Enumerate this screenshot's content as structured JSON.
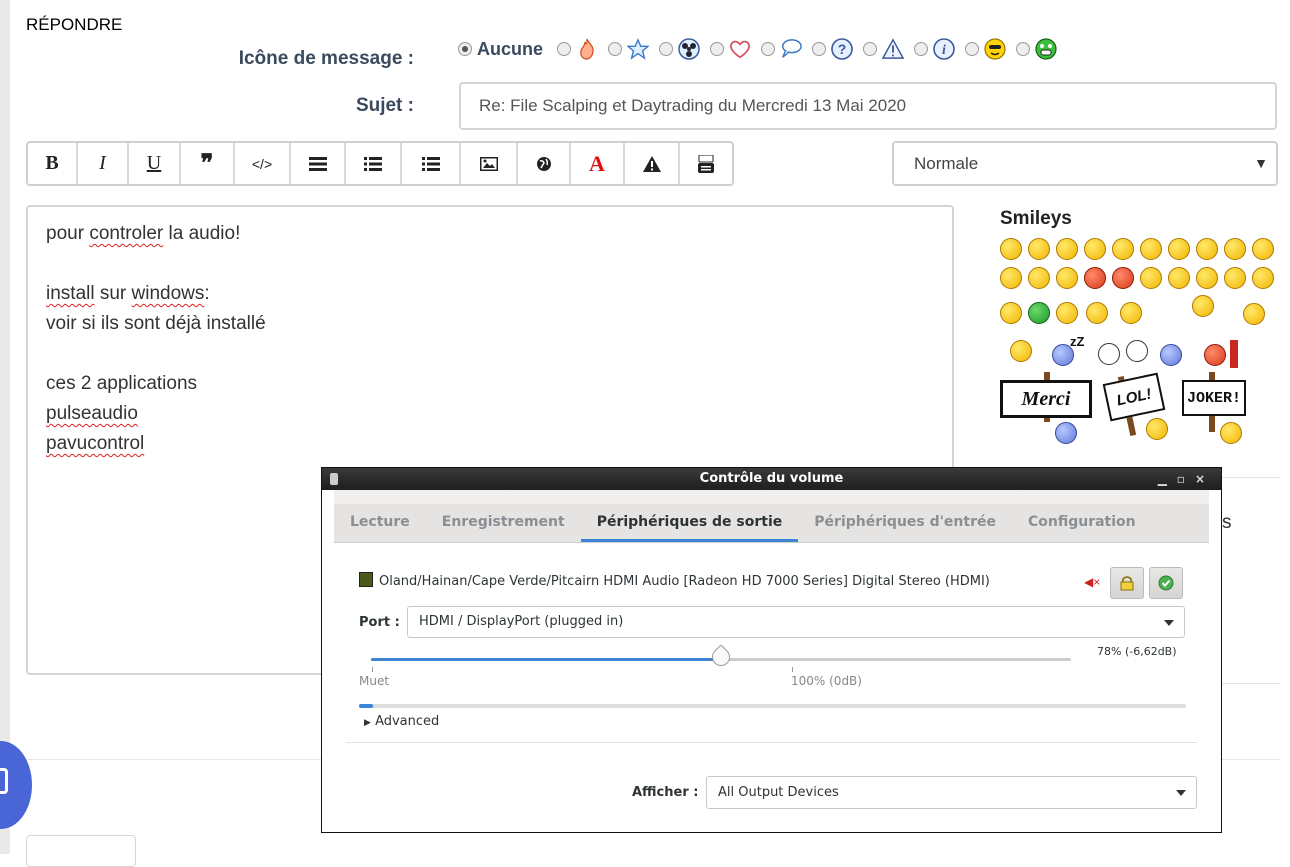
{
  "page": {
    "title": "RÉPONDRE"
  },
  "form": {
    "icon_label": "Icône de message :",
    "icon_none": "Aucune",
    "icons": [
      "fire-icon",
      "star-icon",
      "radioactive-icon",
      "heart-icon",
      "speech-bubble-icon",
      "question-icon",
      "warning-icon",
      "info-icon",
      "yellow-smiley-icon",
      "green-smiley-icon"
    ],
    "subject_label": "Sujet :",
    "subject_value": "Re: File Scalping et Daytrading du Mercredi 13 Mai 2020"
  },
  "toolbar": {
    "bold": "B",
    "italic": "I",
    "underline": "U",
    "quote": "❞",
    "code": "</>",
    "font_size_value": "Normale"
  },
  "editor": {
    "line1_a": "pour ",
    "line1_b": "controler",
    "line1_c": " la audio!",
    "line3_a": "install",
    "line3_b": " sur ",
    "line3_c": "windows",
    "line3_d": ":",
    "line4": "voir si ils sont déjà installé",
    "line6": "ces 2 applications",
    "line7": "pulseaudio",
    "line8": "pavucontrol"
  },
  "smileys": {
    "title": "Smileys",
    "sign_merci": "Merci",
    "sign_lol": "LOL!",
    "sign_joker": "JOKER!",
    "zz": "zZ"
  },
  "volume_window": {
    "title": "Contrôle du volume",
    "tabs": [
      "Lecture",
      "Enregistrement",
      "Périphériques de sortie",
      "Périphériques d'entrée",
      "Configuration"
    ],
    "active_tab": 2,
    "device_name": "Oland/Hainan/Cape Verde/Pitcairn HDMI Audio [Radeon HD 7000 Series] Digital Stereo (HDMI)",
    "port_label": "Port :",
    "port_value": "HDMI / DisplayPort (plugged in)",
    "volume_text": "78% (-6,62dB)",
    "volume_fraction": 0.5,
    "scale_mute": "Muet",
    "scale_100": "100% (0dB)",
    "advanced": "Advanced",
    "show_label": "Afficher :",
    "show_value": "All Output Devices"
  },
  "peek_text": "s"
}
